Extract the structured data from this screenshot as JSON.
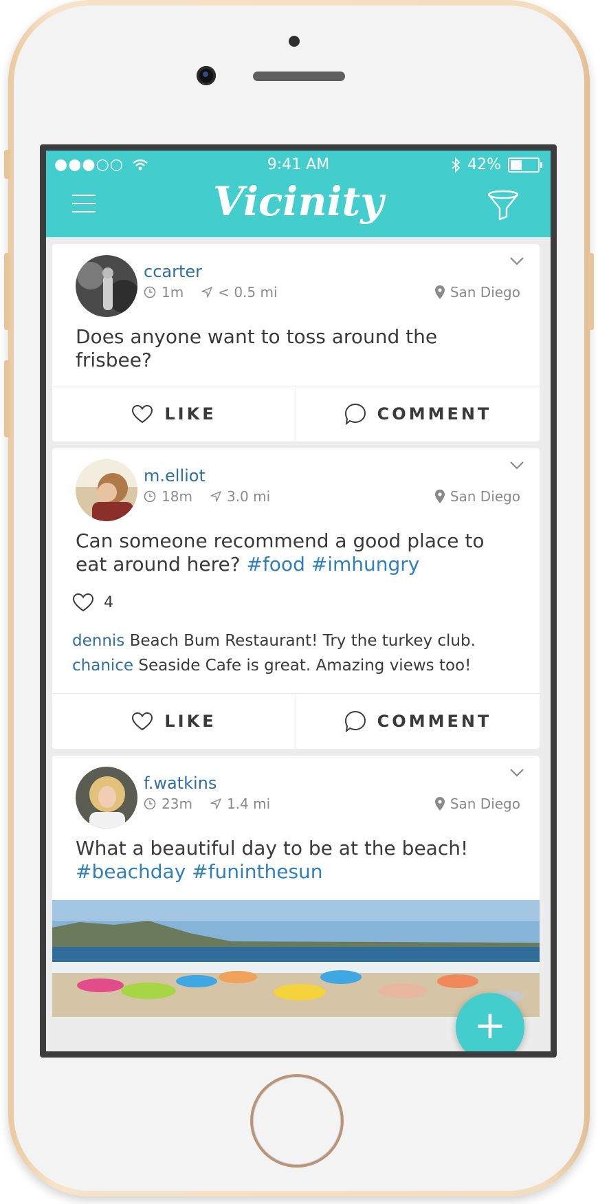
{
  "status_bar": {
    "signal": "●●●○○",
    "time": "9:41 AM",
    "battery": "42%",
    "battery_level": 0.42
  },
  "app_bar": {
    "title": "Vicinity",
    "menu_icon": "hamburger-menu-icon",
    "filter_icon": "funnel-filter-icon"
  },
  "posts": [
    {
      "username": "ccarter",
      "time_ago": "1m",
      "distance": "< 0.5 mi",
      "location": "San Diego",
      "text": "Does anyone want to toss around the frisbee?",
      "tags": "",
      "like_count": null,
      "comments": []
    },
    {
      "username": "m.elliot",
      "time_ago": "18m",
      "distance": "3.0 mi",
      "location": "San Diego",
      "text": "Can someone recommend a good place to eat around here?",
      "tags": "#food #imhungry",
      "like_count": "4",
      "comments": [
        {
          "user": "dennis",
          "text": "Beach Bum Restaurant! Try the turkey club."
        },
        {
          "user": "chanice",
          "text": "Seaside Cafe is great. Amazing views too!"
        }
      ]
    },
    {
      "username": "f.watkins",
      "time_ago": "23m",
      "distance": "1.4 mi",
      "location": "San Diego",
      "text": "What a beautiful day to be at the beach!",
      "tags": "#beachday #funinthesun",
      "like_count": null,
      "comments": []
    }
  ],
  "actions": {
    "like": "LIKE",
    "comment": "COMMENT"
  },
  "fab": {
    "label": "+"
  },
  "colors": {
    "accent": "#43cdcd",
    "link": "#2f6f9f",
    "hashtag": "#2f7fbf"
  }
}
